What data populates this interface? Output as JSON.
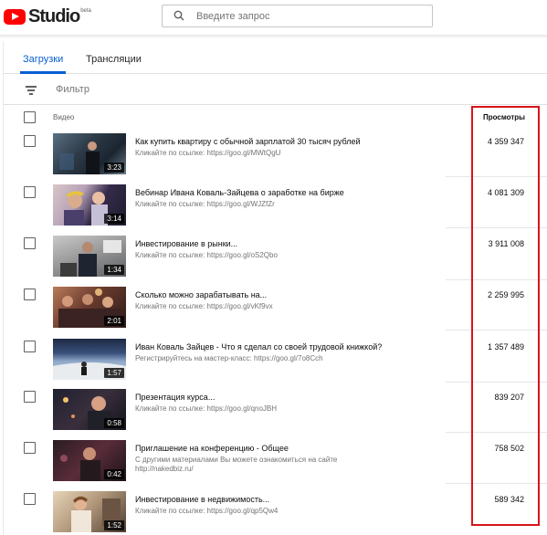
{
  "app": {
    "logo_text": "Studio",
    "logo_badge": "beta"
  },
  "search": {
    "placeholder": "Введите запрос"
  },
  "tabs": [
    {
      "label": "Загрузки",
      "active": true
    },
    {
      "label": "Трансляции",
      "active": false
    }
  ],
  "filter": {
    "placeholder": "Фильтр"
  },
  "columns": {
    "video": "Видео",
    "views": "Просмотры"
  },
  "videos": [
    {
      "title": "Как купить квартиру с обычной зарплатой 30 тысяч рублей",
      "description": "Кликайте по ссылке: https://goo.gl/MWtQgU",
      "duration": "3:23",
      "views": "4 359 347"
    },
    {
      "title": "Вебинар Ивана Коваль-Зайцева о заработке на бирже",
      "description": "Кликайте по ссылке: https://goo.gl/WJZfZr",
      "duration": "3:14",
      "views": "4 081 309"
    },
    {
      "title": "Инвестирование в рынки...",
      "description": "Кликайте по ссылке: https://goo.gl/oS2Qbo",
      "duration": "1:34",
      "views": "3 911 008"
    },
    {
      "title": "Сколько можно зарабатывать на...",
      "description": "Кликайте по ссылке: https://goo.gl/vKf9vx",
      "duration": "2:01",
      "views": "2 259 995"
    },
    {
      "title": "Иван Коваль Зайцев - Что я сделал со своей трудовой книжкой?",
      "description": "Регистрируйтесь на мастер-класс: https://goo.gl/7o8Cch",
      "duration": "1:57",
      "views": "1 357 489"
    },
    {
      "title": "Презентация курса...",
      "description": "Кликайте по ссылке: https://goo.gl/qnoJBH",
      "duration": "0:58",
      "views": "839 207"
    },
    {
      "title": "Приглашение на конференцию - Общее",
      "description": "С другими материалами Вы можете ознакомиться на сайте http://nakedbiz.ru/",
      "duration": "0:42",
      "views": "758 502"
    },
    {
      "title": "Инвестирование в недвижимость...",
      "description": "Кликайте по ссылке: https://goo.gl/qp5Qw4",
      "duration": "1:52",
      "views": "589 342"
    }
  ],
  "colors": {
    "accent": "#065fd4",
    "brand": "#ff0000",
    "highlight": "#d7141a"
  }
}
